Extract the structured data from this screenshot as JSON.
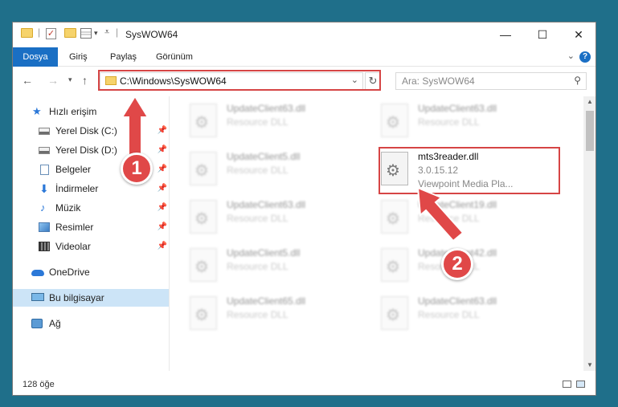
{
  "window": {
    "title": "SysWOW64"
  },
  "ribbon": {
    "tabs": [
      "Dosya",
      "Giriş",
      "Paylaş",
      "Görünüm"
    ],
    "accent": "#1a6fc4"
  },
  "address": {
    "path": "C:\\Windows\\SysWOW64"
  },
  "search": {
    "placeholder": "Ara: SysWOW64"
  },
  "nav": {
    "quick_access": "Hızlı erişim",
    "items": [
      {
        "label": "Yerel Disk (C:)",
        "icon": "drive-icon",
        "pinned": true
      },
      {
        "label": "Yerel Disk (D:)",
        "icon": "drive-icon",
        "pinned": true
      },
      {
        "label": "Belgeler",
        "icon": "documents-icon",
        "pinned": true
      },
      {
        "label": "İndirmeler",
        "icon": "downloads-icon",
        "pinned": true
      },
      {
        "label": "Müzik",
        "icon": "music-icon",
        "pinned": true
      },
      {
        "label": "Resimler",
        "icon": "pictures-icon",
        "pinned": true
      },
      {
        "label": "Videolar",
        "icon": "videos-icon",
        "pinned": true
      }
    ],
    "onedrive": "OneDrive",
    "this_pc": "Bu bilgisayar",
    "network": "Ağ"
  },
  "files": {
    "left": [
      {
        "name": "UpdateClient63.dll",
        "type": "Resource DLL"
      },
      {
        "name": "UpdateClient5.dll",
        "type": "Resource DLL"
      },
      {
        "name": "UpdateClient63.dll",
        "type": "Resource DLL"
      },
      {
        "name": "UpdateClient5.dll",
        "type": "Resource DLL"
      },
      {
        "name": "UpdateClient65.dll",
        "type": "Resource DLL"
      }
    ],
    "right_top": {
      "name": "UpdateClient63.dll",
      "type": "Resource DLL"
    },
    "highlighted": {
      "name": "mts3reader.dll",
      "version": "3.0.15.12",
      "company": "Viewpoint Media Pla..."
    },
    "right_rest": [
      {
        "name": "UpdateClient19.dll",
        "type": "Resource DLL"
      },
      {
        "name": "UpdateClient42.dll",
        "type": "Resource DLL"
      },
      {
        "name": "UpdateClient63.dll",
        "type": "Resource DLL"
      }
    ]
  },
  "status": {
    "count": "128 öğe"
  },
  "annotations": {
    "step1": "1",
    "step2": "2",
    "highlight_color": "#d64545"
  }
}
